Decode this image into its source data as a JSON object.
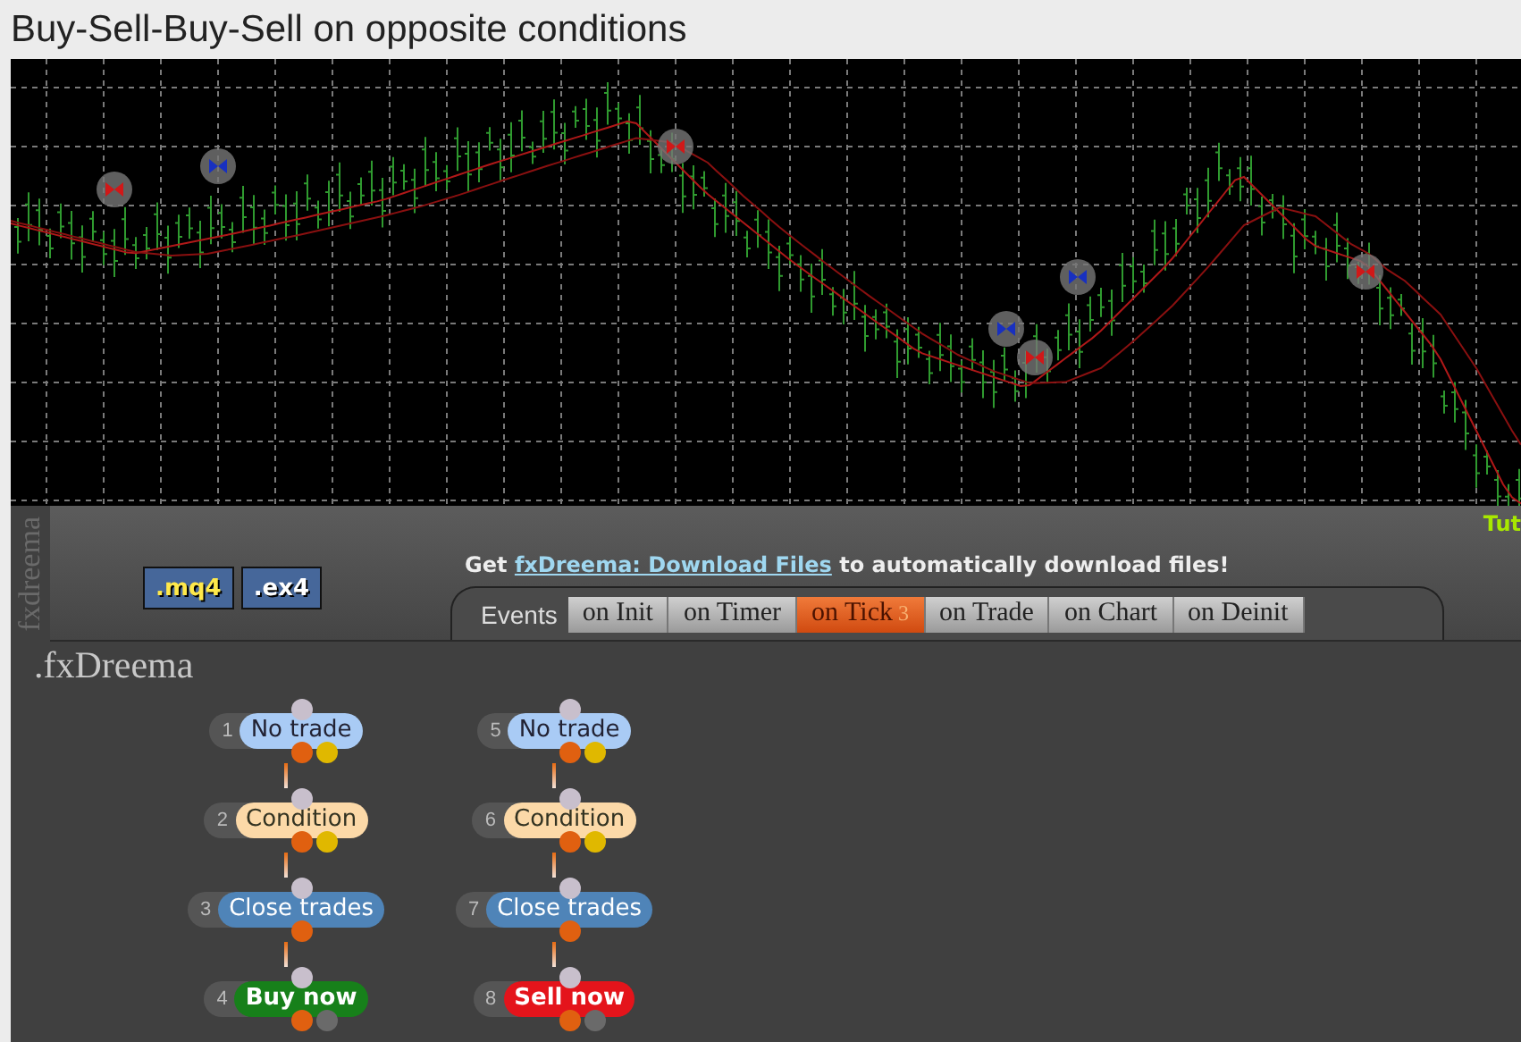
{
  "title": "Buy-Sell-Buy-Sell on opposite conditions",
  "side_label": "fxdreema",
  "corner_link": "Tut",
  "file_buttons": [
    {
      "label": ".mq4",
      "selected": true
    },
    {
      "label": ".ex4",
      "selected": false
    }
  ],
  "notice": {
    "prefix": "Get",
    "link": "fxDreema: Download Files",
    "suffix": "to automatically download files!"
  },
  "events_label": "Events",
  "tabs": [
    {
      "label": "on Init",
      "selected": false
    },
    {
      "label": "on Timer",
      "selected": false
    },
    {
      "label": "on Tick",
      "badge": "3",
      "selected": true
    },
    {
      "label": "on Trade",
      "selected": false
    },
    {
      "label": "on Chart",
      "selected": false
    },
    {
      "label": "on Deinit",
      "selected": false
    }
  ],
  "brand": ".fxDreema",
  "columns": [
    {
      "nodes": [
        {
          "number": "1",
          "label": "No trade",
          "kind": "check"
        },
        {
          "number": "2",
          "label": "Condition",
          "kind": "condition"
        },
        {
          "number": "3",
          "label": "Close trades",
          "kind": "action"
        },
        {
          "number": "4",
          "label": "Buy now",
          "kind": "buy"
        }
      ]
    },
    {
      "nodes": [
        {
          "number": "5",
          "label": "No trade",
          "kind": "check"
        },
        {
          "number": "6",
          "label": "Condition",
          "kind": "condition"
        },
        {
          "number": "7",
          "label": "Close trades",
          "kind": "action"
        },
        {
          "number": "8",
          "label": "Sell now",
          "kind": "sell"
        }
      ]
    }
  ]
}
